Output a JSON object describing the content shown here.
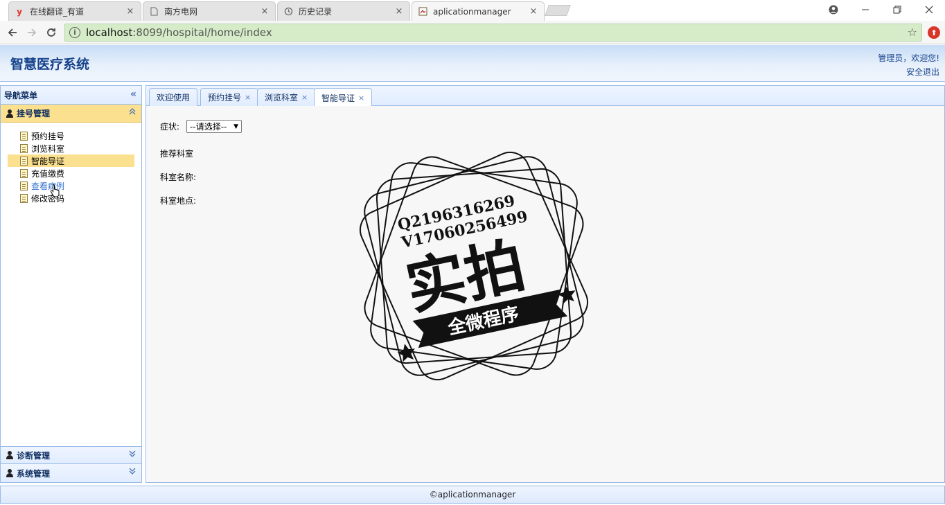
{
  "browser": {
    "tabs": [
      {
        "title": "在线翻译_有道",
        "favicon": "youdao-y",
        "active": false
      },
      {
        "title": "南方电网",
        "favicon": "page",
        "active": false
      },
      {
        "title": "历史记录",
        "favicon": "history",
        "active": false
      },
      {
        "title": "aplicationmanager",
        "favicon": "app",
        "active": true
      }
    ],
    "close_glyph": "×",
    "url_host": "localhost",
    "url_rest": ":8099/hospital/home/index"
  },
  "header": {
    "title": "智慧医疗系统",
    "welcome": "管理员，欢迎您!",
    "logout": "安全退出"
  },
  "nav": {
    "title": "导航菜单",
    "groups": [
      {
        "label": "挂号管理",
        "expanded": true,
        "items": [
          {
            "label": "预约挂号"
          },
          {
            "label": "浏览科室"
          },
          {
            "label": "智能导证",
            "selected": true
          },
          {
            "label": "充值缴费"
          },
          {
            "label": "查看病例",
            "hovered": true
          },
          {
            "label": "修改密码"
          }
        ]
      },
      {
        "label": "诊断管理",
        "expanded": false
      },
      {
        "label": "系统管理",
        "expanded": false
      }
    ]
  },
  "center": {
    "tabs": [
      {
        "label": "欢迎使用",
        "closable": false
      },
      {
        "label": "预约挂号",
        "closable": true
      },
      {
        "label": "浏览科室",
        "closable": true
      },
      {
        "label": "智能导证",
        "closable": true,
        "active": true
      }
    ],
    "close_glyph": "×",
    "form": {
      "symptom_label": "症状:",
      "symptom_value": "--请选择--",
      "recommend_label": "推荐科室",
      "dept_name_label": "科室名称:",
      "dept_location_label": "科室地点:"
    }
  },
  "watermark": {
    "line1": "Q2196316269",
    "line2": "V17060256499",
    "main": "实拍",
    "banner": "全微程序"
  },
  "footer": {
    "text": "©aplicationmanager"
  }
}
